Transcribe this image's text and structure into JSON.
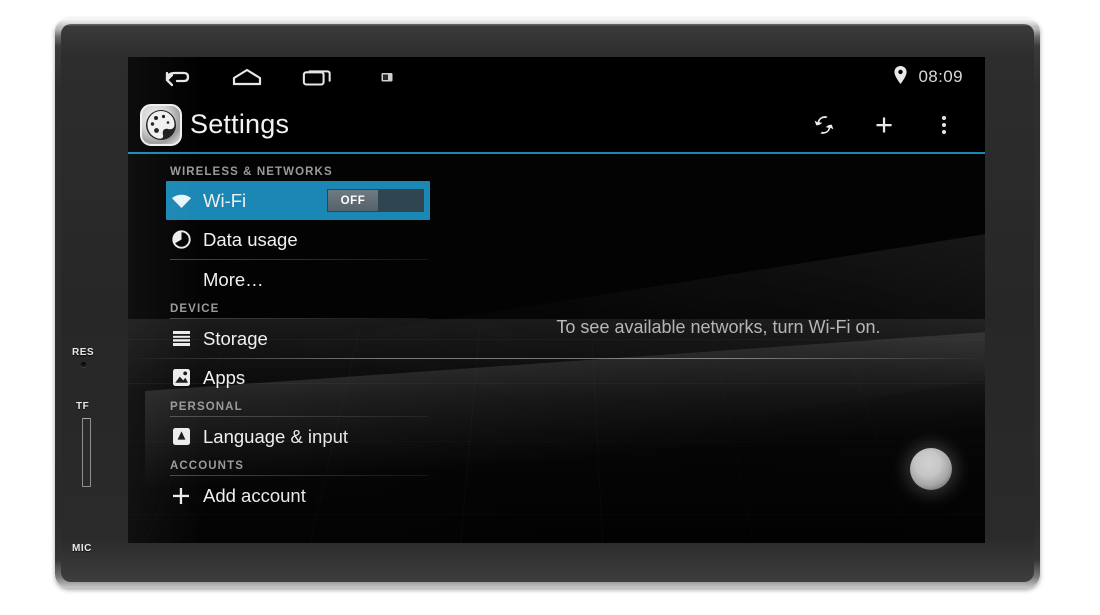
{
  "device": {
    "hardware_labels": [
      {
        "name": "res-label",
        "text": "RES"
      },
      {
        "name": "tf-label",
        "text": "TF"
      },
      {
        "name": "mic-label",
        "text": "MIC"
      }
    ]
  },
  "statusbar": {
    "nav": [
      {
        "icon": "back-icon",
        "label": "Back"
      },
      {
        "icon": "home-icon",
        "label": "Home"
      },
      {
        "icon": "recents-icon",
        "label": "Recents"
      },
      {
        "icon": "screenshot-icon",
        "label": "Screenshot"
      }
    ],
    "location_icon": "location-pin-icon",
    "time": "08:09"
  },
  "actionbar": {
    "app_icon": "settings-app-icon",
    "title": "Settings",
    "actions": [
      {
        "icon": "sync-icon",
        "label": "Sync"
      },
      {
        "icon": "plus-icon",
        "label": "Add"
      },
      {
        "icon": "overflow-menu-icon",
        "label": "More options"
      }
    ],
    "plus_glyph": "+",
    "accent_color": "#1b87b5"
  },
  "settings": {
    "sections": [
      {
        "header": "WIRELESS & NETWORKS",
        "rows": [
          {
            "label": "Wi-Fi",
            "icon": "wifi-icon",
            "selected": true,
            "toggle": {
              "state": "OFF"
            }
          },
          {
            "label": "Data usage",
            "icon": "data-usage-icon",
            "selected": false
          },
          {
            "label": "More…",
            "icon": "none",
            "selected": false,
            "indent": true
          }
        ]
      },
      {
        "header": "DEVICE",
        "rows": [
          {
            "label": "Storage",
            "icon": "storage-icon",
            "selected": false
          },
          {
            "label": "Apps",
            "icon": "apps-icon",
            "selected": false
          }
        ]
      },
      {
        "header": "PERSONAL",
        "rows": [
          {
            "label": "Language & input",
            "icon": "language-input-icon",
            "selected": false
          }
        ]
      },
      {
        "header": "ACCOUNTS",
        "rows": [
          {
            "label": "Add account",
            "icon": "plus-icon",
            "selected": false
          }
        ]
      }
    ]
  },
  "content": {
    "empty_hint": "To see available networks, turn Wi-Fi on."
  },
  "colors": {
    "accent": "#1b87b5",
    "screen_bg": "#000000",
    "text_primary": "#f0f0f0",
    "text_secondary": "#9a9a9a"
  }
}
